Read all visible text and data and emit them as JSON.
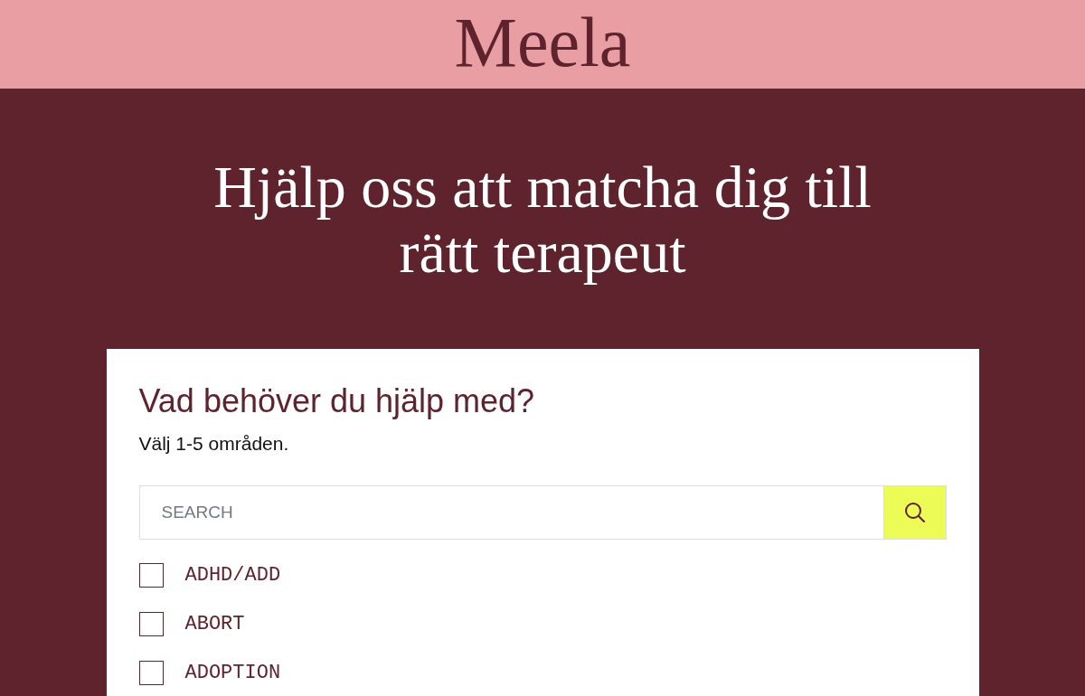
{
  "header": {
    "logo": "Meela"
  },
  "hero": {
    "heading": "Hjälp oss att matcha dig till rätt terapeut"
  },
  "form": {
    "title": "Vad behöver du hjälp med?",
    "subtitle": "Välj 1-5 områden.",
    "search": {
      "placeholder": "SEARCH"
    },
    "options": [
      {
        "label": "ADHD/ADD",
        "checked": false
      },
      {
        "label": "ABORT",
        "checked": false
      },
      {
        "label": "ADOPTION",
        "checked": false
      }
    ]
  }
}
